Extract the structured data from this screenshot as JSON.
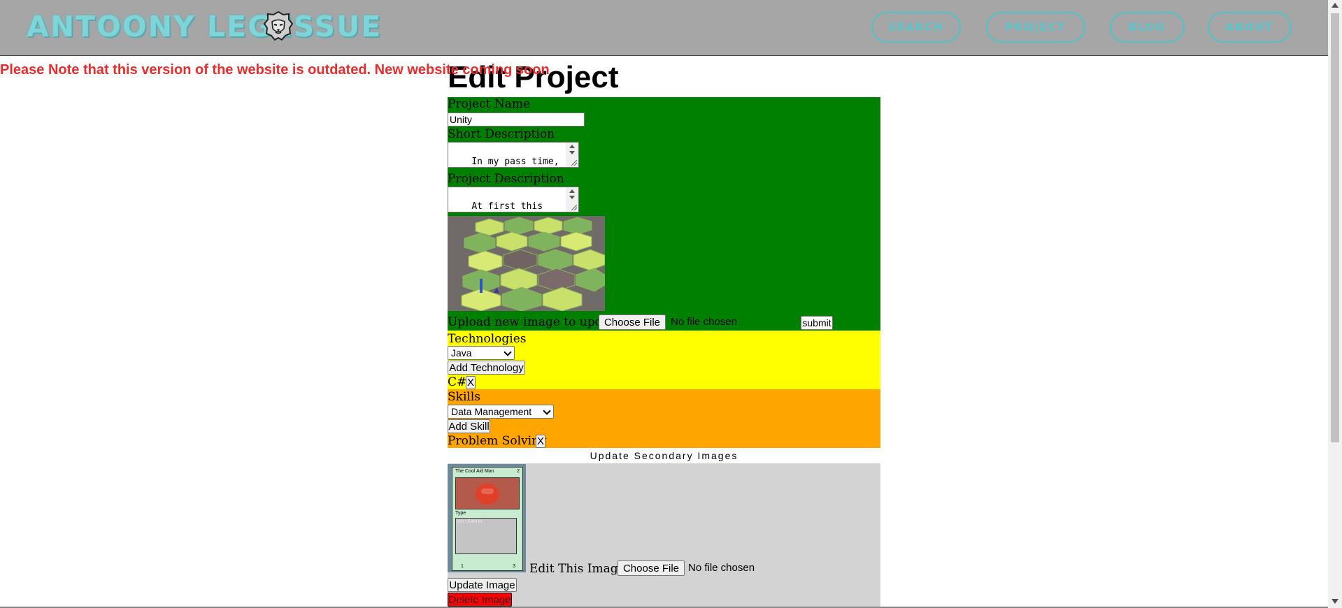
{
  "header": {
    "logo_text": "ANTOONY LEGESSUE",
    "logo_icon": "lion-head-icon",
    "nav": [
      {
        "label": "SEARCH"
      },
      {
        "label": "PROJECT"
      },
      {
        "label": "BLOG"
      },
      {
        "label": "ABOUT"
      }
    ]
  },
  "notice": "Please Note that this version of the website is outdated. New website coming soon",
  "page_title": "Edit Project",
  "form": {
    "project_name_label": "Project Name",
    "project_name_value": "Unity",
    "short_desc_label": "Short Description",
    "short_desc_value": "In my pass time,\nI've spent some time",
    "project_desc_label": "Project Description",
    "project_desc_value": "At first this\nstarted as a card",
    "upload_label": "Upload new image to update:",
    "choose_file_label": "Choose File",
    "no_file_text": "No file chosen",
    "submit_label": "submit"
  },
  "technologies": {
    "label": "Technologies",
    "select_value": "Java",
    "add_label": "Add Technology",
    "items": [
      {
        "name": "C#",
        "remove": "X"
      }
    ]
  },
  "skills": {
    "label": "Skills",
    "select_value": "Data Management",
    "add_label": "Add Skill",
    "items": [
      {
        "name": "Problem Solving",
        "remove": "X"
      }
    ]
  },
  "secondary": {
    "title": "Update Secondary Images",
    "card": {
      "name": "The Cool Aid Man",
      "cost": "2",
      "type": "Type",
      "text": "OH YEAHHH",
      "atk": "1",
      "def": "3"
    },
    "edit_label": "Edit This Image:",
    "choose_file_label": "Choose File",
    "no_file_text": "No file chosen",
    "update_label": "Update Image",
    "delete_label": "Delete Image"
  },
  "colors": {
    "header_bg": "#a6a6a6",
    "accent": "#4ec3c9",
    "notice": "#ee2b2b",
    "green": "#008000",
    "yellow": "#ffff00",
    "orange": "#ffa500",
    "grey": "#d3d3d3",
    "delete": "#ff0000"
  }
}
